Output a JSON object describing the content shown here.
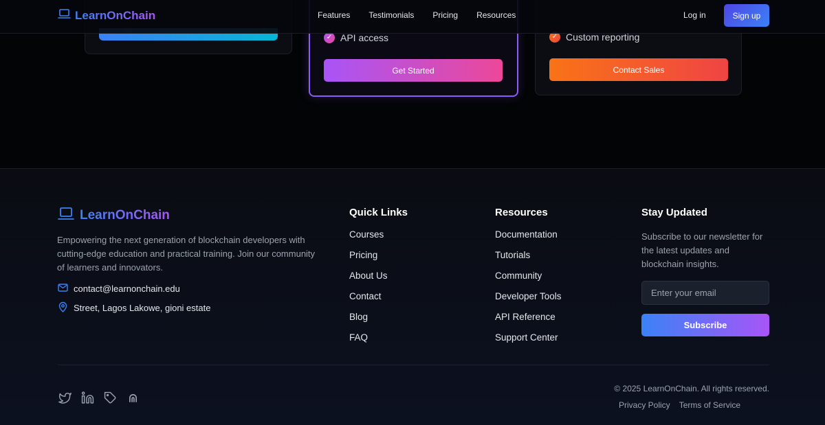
{
  "nav": {
    "brand": "LearnOnChain",
    "links": [
      "Features",
      "Testimonials",
      "Pricing",
      "Resources"
    ],
    "login": "Log in",
    "signup": "Sign up"
  },
  "pricing": {
    "pro": {
      "feature": "API access",
      "button": "Get Started"
    },
    "enterprise": {
      "feature": "Custom reporting",
      "button": "Contact Sales"
    }
  },
  "footer": {
    "brand": "LearnOnChain",
    "description": "Empowering the next generation of blockchain developers with cutting-edge education and practical training. Join our community of learners and innovators.",
    "email": "contact@learnonchain.edu",
    "address": "Street, Lagos Lakowe, gioni estate",
    "quick_links": {
      "title": "Quick Links",
      "items": [
        "Courses",
        "Pricing",
        "About Us",
        "Contact",
        "Blog",
        "FAQ"
      ]
    },
    "resources": {
      "title": "Resources",
      "items": [
        "Documentation",
        "Tutorials",
        "Community",
        "Developer Tools",
        "API Reference",
        "Support Center"
      ]
    },
    "newsletter": {
      "title": "Stay Updated",
      "description": "Subscribe to our newsletter for the latest updates and blockchain insights.",
      "placeholder": "Enter your email",
      "button": "Subscribe"
    },
    "socials": [
      "twitter-icon",
      "linkedin-icon",
      "tag-icon",
      "arch-icon"
    ],
    "copyright": "© 2025 LearnOnChain. All rights reserved.",
    "legal": [
      "Privacy Policy",
      "Terms of Service"
    ]
  },
  "colors": {
    "brand_gradient": [
      "#3b82f6",
      "#a855f7"
    ],
    "pro_accent": "#a855f7",
    "enterprise_accent": "#f97316",
    "background": "#030406"
  }
}
